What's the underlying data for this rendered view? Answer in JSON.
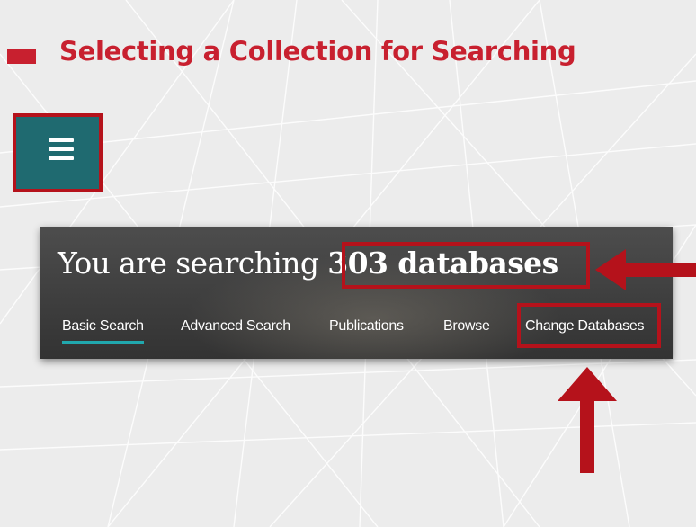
{
  "slide": {
    "title": "Selecting a Collection for Searching"
  },
  "menu": {
    "icon": "hamburger-menu-icon"
  },
  "search_panel": {
    "heading_prefix": "You are searching",
    "database_count": "303 databases",
    "tabs": [
      {
        "label": "Basic Search",
        "active": true
      },
      {
        "label": "Advanced Search",
        "active": false
      },
      {
        "label": "Publications",
        "active": false
      },
      {
        "label": "Browse",
        "active": false
      },
      {
        "label": "Change Databases",
        "active": false
      }
    ]
  },
  "colors": {
    "accent_red": "#c8202f",
    "highlight_red": "#b5121b",
    "menu_teal": "#1f6a70",
    "tab_underline": "#21a8ae"
  }
}
